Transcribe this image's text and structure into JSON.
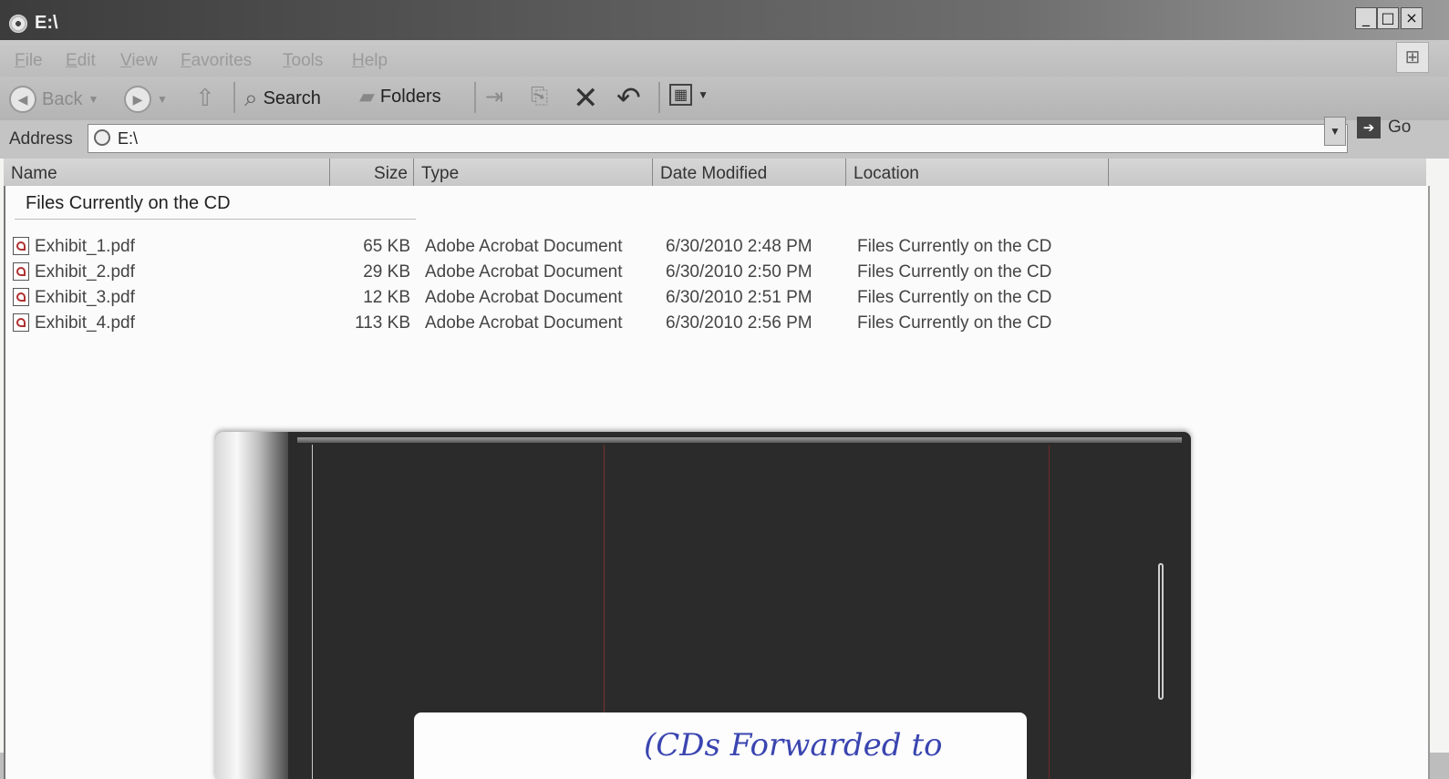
{
  "window": {
    "title": "E:\\",
    "minimize_glyph": "_",
    "maximize_glyph": "□",
    "close_glyph": "×"
  },
  "menu": [
    "File",
    "Edit",
    "View",
    "Favorites",
    "Tools",
    "Help"
  ],
  "toolbar": {
    "back_label": "Back",
    "search_label": "Search",
    "folders_label": "Folders"
  },
  "address": {
    "label": "Address",
    "value": "E:\\",
    "go_label": "Go"
  },
  "columns": [
    "Name",
    "Size",
    "Type",
    "Date Modified",
    "Location"
  ],
  "group_title": "Files Currently on the CD",
  "files": [
    {
      "name": "Exhibit_1.pdf",
      "size": "65 KB",
      "type": "Adobe Acrobat Document",
      "modified": "6/30/2010 2:48 PM",
      "location": "Files Currently on the CD"
    },
    {
      "name": "Exhibit_2.pdf",
      "size": "29 KB",
      "type": "Adobe Acrobat Document",
      "modified": "6/30/2010 2:50 PM",
      "location": "Files Currently on the CD"
    },
    {
      "name": "Exhibit_3.pdf",
      "size": "12 KB",
      "type": "Adobe Acrobat Document",
      "modified": "6/30/2010 2:51 PM",
      "location": "Files Currently on the CD"
    },
    {
      "name": "Exhibit_4.pdf",
      "size": "113 KB",
      "type": "Adobe Acrobat Document",
      "modified": "6/30/2010 2:56 PM",
      "location": "Files Currently on the CD"
    }
  ],
  "handwritten_note": "(CDs Forwarded to",
  "colors": {
    "titlebar": "#3c3c3c",
    "cd_case": "#2b2b2b",
    "ink": "#3a45b0"
  }
}
